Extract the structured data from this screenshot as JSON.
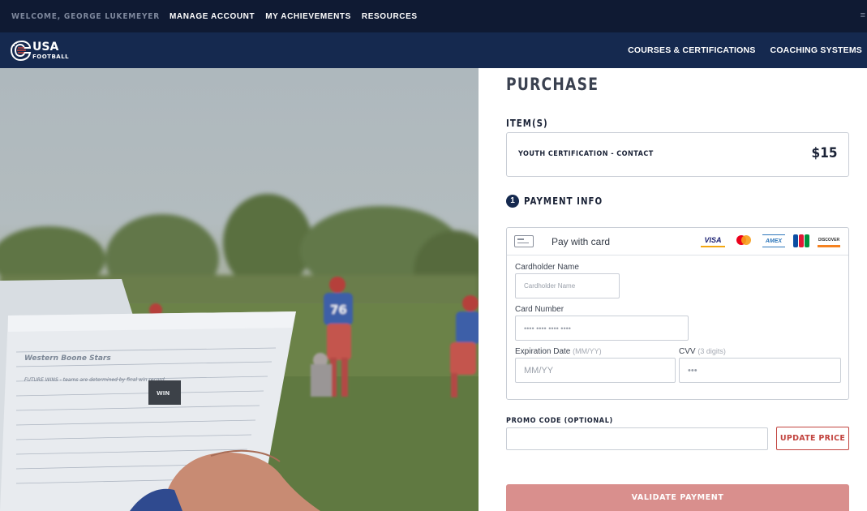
{
  "topbar": {
    "welcome": "WELCOME, GEORGE LUKEMEYER",
    "links": [
      "MANAGE ACCOUNT",
      "MY ACHIEVEMENTS",
      "RESOURCES"
    ]
  },
  "header": {
    "logo_text_top": "USA",
    "logo_text_bottom": "FOOTBALL",
    "nav": [
      "COURSES & CERTIFICATIONS",
      "COACHING SYSTEMS"
    ]
  },
  "purchase": {
    "title": "PURCHASE",
    "items_label": "ITEM(S)",
    "item": {
      "name": "YOUTH CERTIFICATION - CONTACT",
      "price": "$15"
    },
    "step_number": "1",
    "payment_label": "PAYMENT INFO",
    "card": {
      "pay_with": "Pay with card",
      "brands": [
        "VISA",
        "mastercard",
        "AMEX",
        "JCB",
        "DISCOVER"
      ],
      "cardholder_label": "Cardholder Name",
      "cardholder_placeholder": "Cardholder Name",
      "card_number_label": "Card Number",
      "card_number_placeholder": "•••• •••• •••• ••••",
      "expiration_label": "Expiration Date",
      "expiration_hint": "(MM/YY)",
      "expiration_placeholder": "MM/YY",
      "cvv_label": "CVV",
      "cvv_hint": "(3 digits)",
      "cvv_placeholder": "•••"
    },
    "promo_label": "PROMO CODE (OPTIONAL)",
    "promo_value": "",
    "update_button": "UPDATE PRICE",
    "validate_button": "VALIDATE PAYMENT"
  },
  "hero_sheet_text": {
    "team": "Western Boone Stars",
    "line1": "FUTURE WINS - teams are determined by final win record",
    "tag": "WIN"
  },
  "colors": {
    "topbar": "#0f1a33",
    "navbar": "#15294f",
    "accent_red": "#c2443f",
    "validate_disabled": "#d98f8d"
  }
}
